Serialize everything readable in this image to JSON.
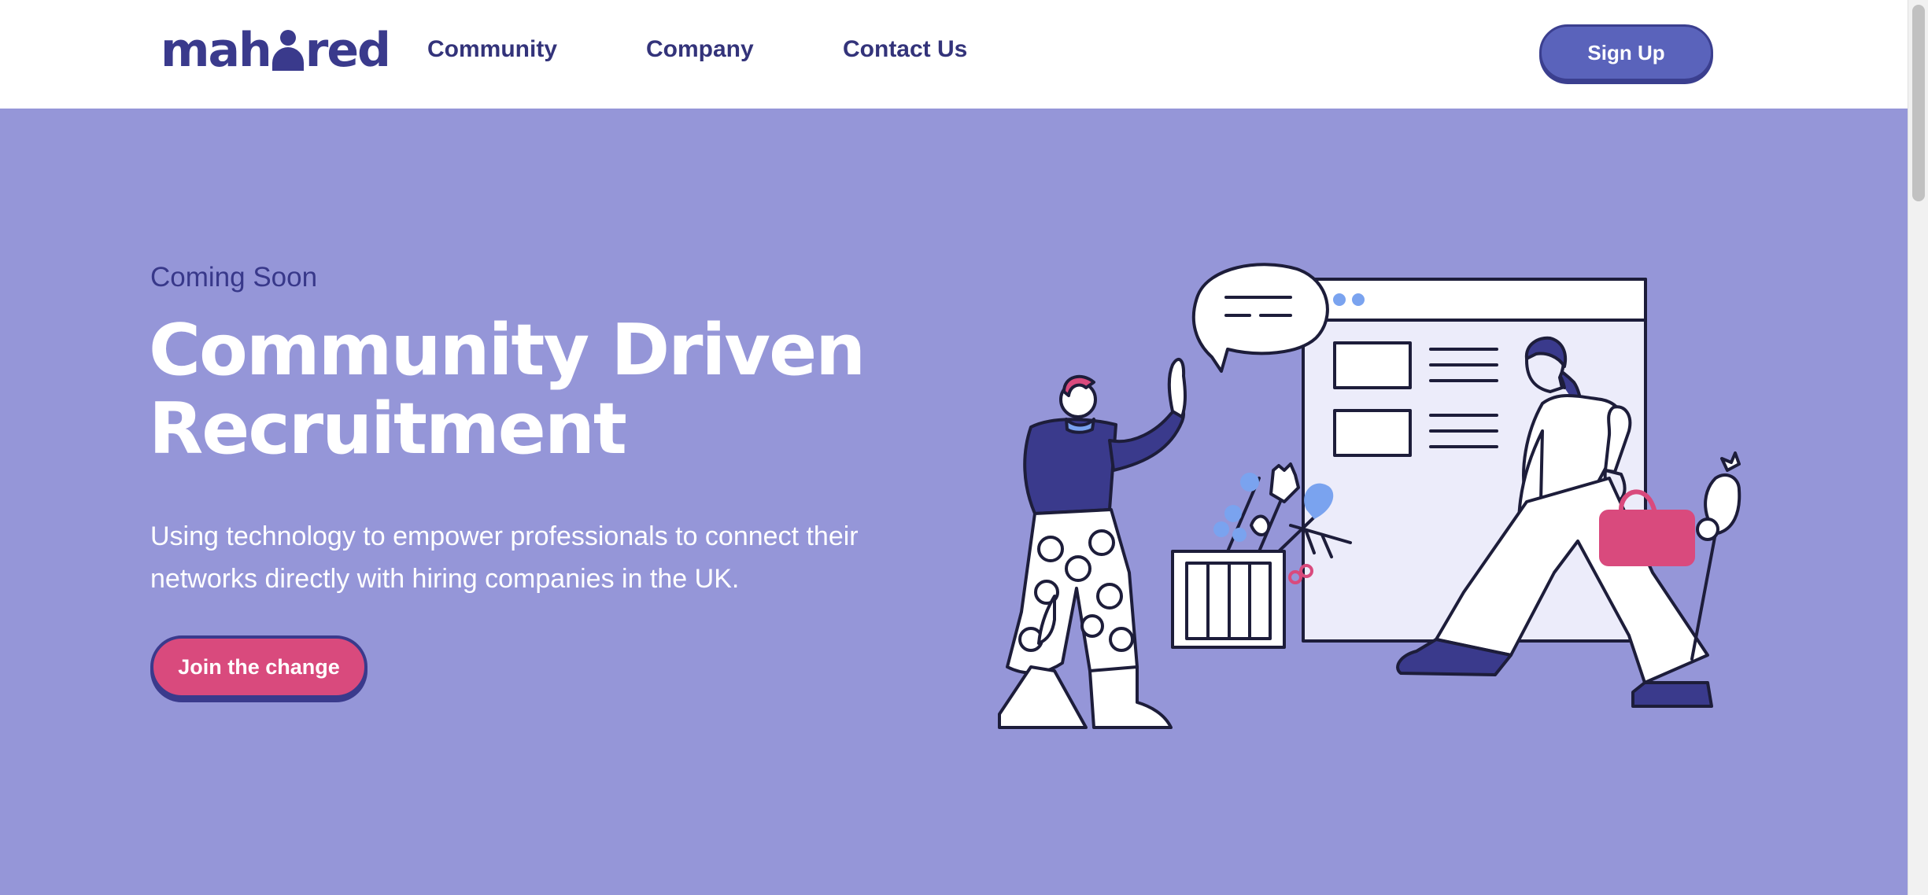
{
  "brand": {
    "logo_left": "mah",
    "logo_right": "red"
  },
  "nav": {
    "links": [
      {
        "label": "Community"
      },
      {
        "label": "Company"
      },
      {
        "label": "Contact Us"
      }
    ],
    "signup_label": "Sign Up"
  },
  "hero": {
    "eyebrow": "Coming Soon",
    "title_line1": "Community Driven",
    "title_line2": "Recruitment",
    "description": "Using technology to empower professionals to connect their networks directly with hiring companies in the UK.",
    "cta_label": "Join the change"
  },
  "colors": {
    "hero_bg": "#9596d8",
    "brand_navy": "#3a3a8c",
    "signup_blue": "#5a63bb",
    "cta_pink": "#d94a7d"
  }
}
